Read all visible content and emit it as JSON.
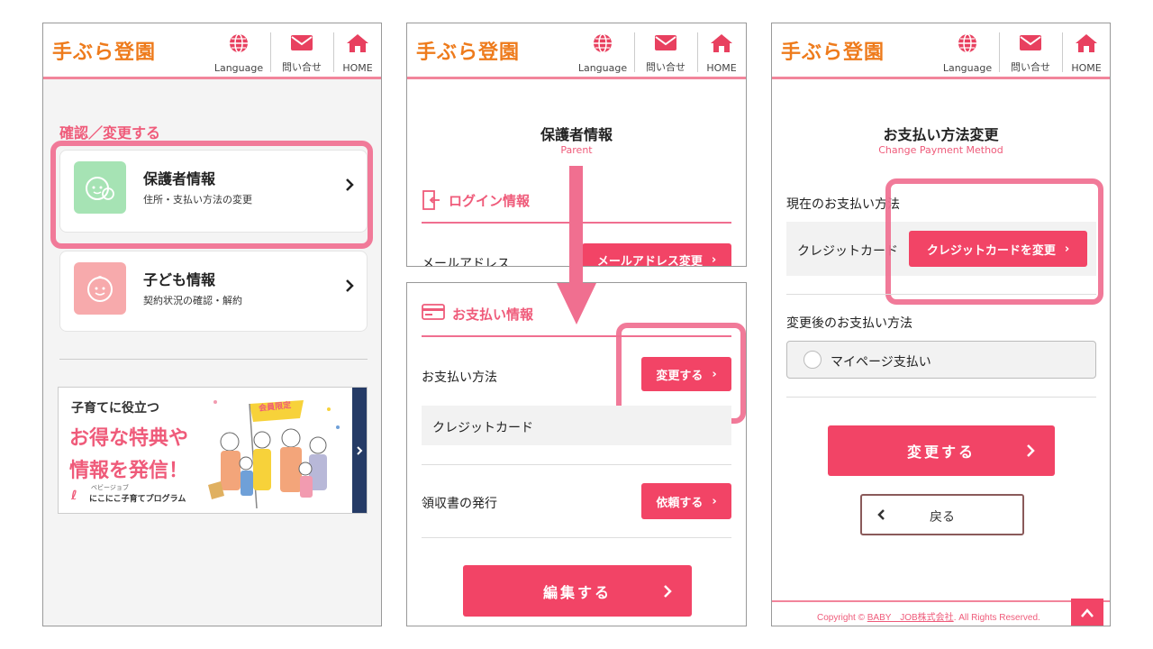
{
  "header": {
    "logo": "手ぶら登園",
    "nav": [
      {
        "label": "Language",
        "icon": "globe-icon"
      },
      {
        "label": "問い合せ",
        "icon": "mail-icon"
      },
      {
        "label": "HOME",
        "icon": "home-icon"
      }
    ]
  },
  "screen1": {
    "section_title": "確認／変更する",
    "cards": [
      {
        "title": "保護者情報",
        "subtitle": "住所・支払い方法の変更"
      },
      {
        "title": "子ども情報",
        "subtitle": "契約状況の確認・解約"
      }
    ],
    "banner": {
      "line1": "子育てに役立つ",
      "line2": "お得な特典や",
      "line3": "情報を発信！",
      "badge": "会員限定",
      "small": "ベビージョブ",
      "program": "にこにこ子育てプログラム"
    }
  },
  "screen2": {
    "page_title": "保護者情報",
    "page_sub": "Parent",
    "login_title": "ログイン情報",
    "email_label": "メールアドレス",
    "email_button": "メールアドレス変更",
    "payment_title": "お支払い情報",
    "method_label": "お支払い方法",
    "change_button": "変更する",
    "method_value": "クレジットカード",
    "receipt_label": "領収書の発行",
    "receipt_button": "依頼する",
    "edit_button": "編集する"
  },
  "screen3": {
    "page_title": "お支払い方法変更",
    "page_sub": "Change Payment Method",
    "current_label": "現在のお支払い方法",
    "current_value": "クレジットカード",
    "change_card_button": "クレジットカードを変更",
    "after_label": "変更後のお支払い方法",
    "option": "マイページ支払い",
    "submit_button": "変更する",
    "back_button": "戻る",
    "copyright_prefix": "Copyright © ",
    "copyright_link": "BABY　JOB株式会社",
    "copyright_suffix": ". All Rights Reserved."
  },
  "colors": {
    "accent": "#f24466",
    "highlight": "#f06f90",
    "logo": "#ee7b1c"
  }
}
